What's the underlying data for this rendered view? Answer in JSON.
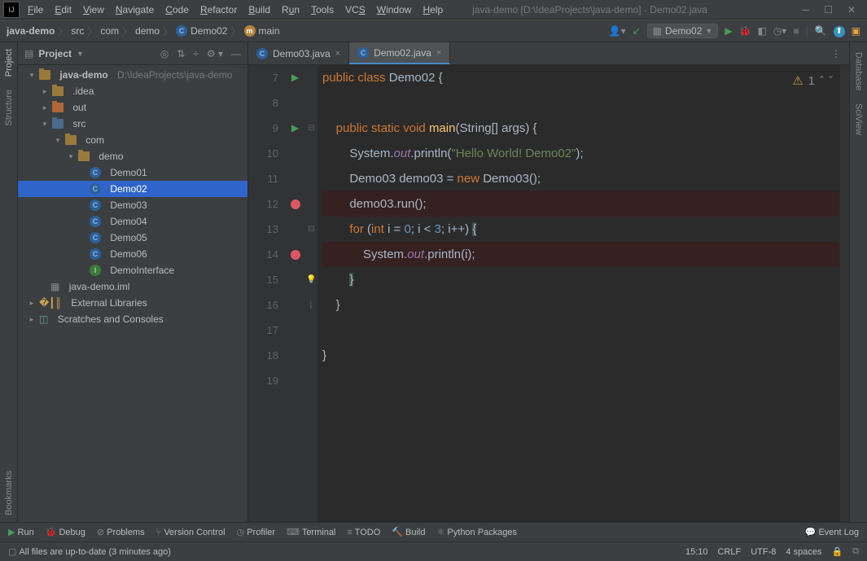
{
  "title": "java-demo [D:\\IdeaProjects\\java-demo] - Demo02.java",
  "menu": [
    "File",
    "Edit",
    "View",
    "Navigate",
    "Code",
    "Refactor",
    "Build",
    "Run",
    "Tools",
    "VCS",
    "Window",
    "Help"
  ],
  "breadcrumbs": {
    "root": "java-demo",
    "p1": "src",
    "p2": "com",
    "p3": "demo",
    "cls": "Demo02",
    "m": "main"
  },
  "run_config": "Demo02",
  "sidebar_title": "Project",
  "tree": {
    "root": "java-demo",
    "root_path": "D:\\IdeaProjects\\java-demo",
    "idea": ".idea",
    "out": "out",
    "src": "src",
    "com": "com",
    "demo": "demo",
    "files": [
      "Demo01",
      "Demo02",
      "Demo03",
      "Demo04",
      "Demo05",
      "Demo06",
      "DemoInterface"
    ],
    "iml": "java-demo.iml",
    "ext": "External Libraries",
    "scr": "Scratches and Consoles"
  },
  "tabs": {
    "t0": "Demo03.java",
    "t1": "Demo02.java"
  },
  "lines": [
    "7",
    "8",
    "9",
    "10",
    "11",
    "12",
    "13",
    "14",
    "15",
    "16",
    "17",
    "18",
    "19"
  ],
  "code": {
    "l7a": "public",
    "l7b": "class",
    "l7c": "Demo02",
    "l7d": "{",
    "l9a": "public",
    "l9b": "static",
    "l9c": "void",
    "l9d": "main",
    "l9e": "(String[] args) {",
    "l10a": "System.",
    "l10b": "out",
    "l10c": ".println(",
    "l10d": "\"Hello World! Demo02\"",
    "l10e": ");",
    "l11a": "Demo03 demo03 = ",
    "l11b": "new",
    "l11c": " Demo03();",
    "l12": "demo03.run();",
    "l13a": "for ",
    "l13b": "(",
    "l13c": "int",
    "l13d": " i",
    "l13e": " = ",
    "l13f": "0",
    "l13g": "; i < ",
    "l13h": "3",
    "l13i": "; i++) ",
    "l13j": "{",
    "l14a": "System.",
    "l14b": "out",
    "l14c": ".println(i);",
    "l15": "}",
    "l16": "}",
    "l18": "}"
  },
  "warn_count": "1",
  "rails": {
    "project": "Project",
    "structure": "Structure",
    "bookmarks": "Bookmarks",
    "database": "Database",
    "sciview": "SciView"
  },
  "bottom": {
    "run": "Run",
    "debug": "Debug",
    "problems": "Problems",
    "vc": "Version Control",
    "profiler": "Profiler",
    "terminal": "Terminal",
    "todo": "TODO",
    "build": "Build",
    "pypkg": "Python Packages",
    "eventlog": "Event Log"
  },
  "status": {
    "msg": "All files are up-to-date (3 minutes ago)",
    "pos": "15:10",
    "eol": "CRLF",
    "enc": "UTF-8",
    "indent": "4 spaces"
  }
}
